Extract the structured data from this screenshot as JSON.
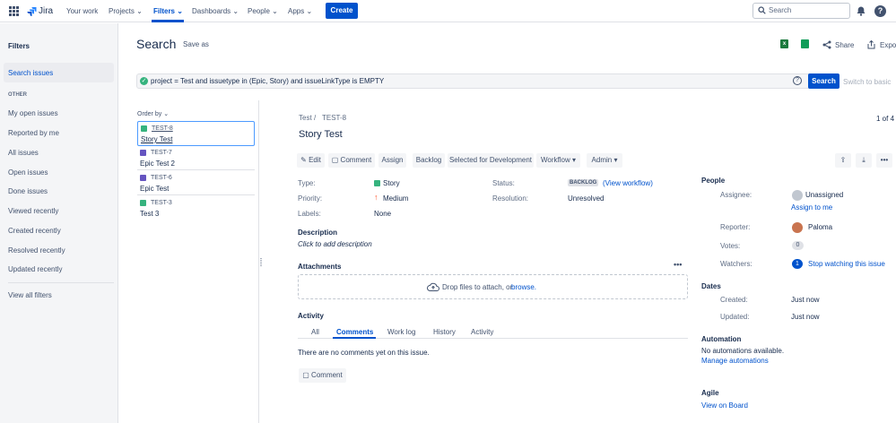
{
  "nav": {
    "logo": "Jira",
    "items": [
      "Your work",
      "Projects",
      "Filters",
      "Dashboards",
      "People",
      "Apps"
    ],
    "create": "Create",
    "search_placeholder": "Search"
  },
  "sidebar": {
    "title": "Filters",
    "search_issues": "Search issues",
    "other": "OTHER",
    "items": [
      "My open issues",
      "Reported by me",
      "All issues",
      "Open issues",
      "Done issues",
      "Viewed recently",
      "Created recently",
      "Resolved recently",
      "Updated recently"
    ],
    "view_all": "View all filters"
  },
  "header": {
    "title": "Search",
    "save_as": "Save as",
    "share": "Share",
    "export": "Expor"
  },
  "jql": {
    "query": "project = Test and issuetype in (Epic, Story) and issueLinkType is EMPTY",
    "search": "Search",
    "switch": "Switch to basic"
  },
  "list": {
    "order_by": "Order by",
    "items": [
      {
        "key": "TEST-8",
        "summary": "Story Test",
        "type": "story"
      },
      {
        "key": "TEST-7",
        "summary": "Epic Test 2",
        "type": "epic"
      },
      {
        "key": "TEST-6",
        "summary": "Epic Test",
        "type": "epic"
      },
      {
        "key": "TEST-3",
        "summary": "Test 3",
        "type": "story"
      }
    ]
  },
  "issue": {
    "project": "Test",
    "key": "TEST-8",
    "count": "1 of 4",
    "title": "Story Test",
    "toolbar": {
      "edit": "Edit",
      "comment": "Comment",
      "assign": "Assign",
      "backlog": "Backlog",
      "selected": "Selected for Development",
      "workflow": "Workflow",
      "admin": "Admin"
    },
    "details": {
      "type_l": "Type:",
      "type_v": "Story",
      "priority_l": "Priority:",
      "priority_v": "Medium",
      "labels_l": "Labels:",
      "labels_v": "None",
      "status_l": "Status:",
      "status_v": "BACKLOG",
      "view_workflow": "(View workflow)",
      "resolution_l": "Resolution:",
      "resolution_v": "Unresolved"
    },
    "description_h": "Description",
    "description_v": "Click to add description",
    "attachments_h": "Attachments",
    "drop": "Drop files to attach, or",
    "browse": "browse.",
    "activity_h": "Activity",
    "tabs": [
      "All",
      "Comments",
      "Work log",
      "History",
      "Activity"
    ],
    "no_comments": "There are no comments yet on this issue.",
    "comment_btn": "Comment"
  },
  "people": {
    "h": "People",
    "assignee_l": "Assignee:",
    "assignee_v": "Unassigned",
    "assign_me": "Assign to me",
    "reporter_l": "Reporter:",
    "reporter_v": "Paloma",
    "votes_l": "Votes:",
    "votes_v": "0",
    "watchers_l": "Watchers:",
    "watchers_v": "1",
    "stop_watching": "Stop watching this issue"
  },
  "dates": {
    "h": "Dates",
    "created_l": "Created:",
    "created_v": "Just now",
    "updated_l": "Updated:",
    "updated_v": "Just now"
  },
  "automation": {
    "h": "Automation",
    "none": "No automations available.",
    "manage": "Manage automations"
  },
  "agile": {
    "h": "Agile",
    "view_board": "View on Board"
  },
  "colors": {
    "accent": "#0052cc",
    "story": "#36b37e",
    "epic": "#6554c0",
    "medium": "#ff8b00"
  }
}
